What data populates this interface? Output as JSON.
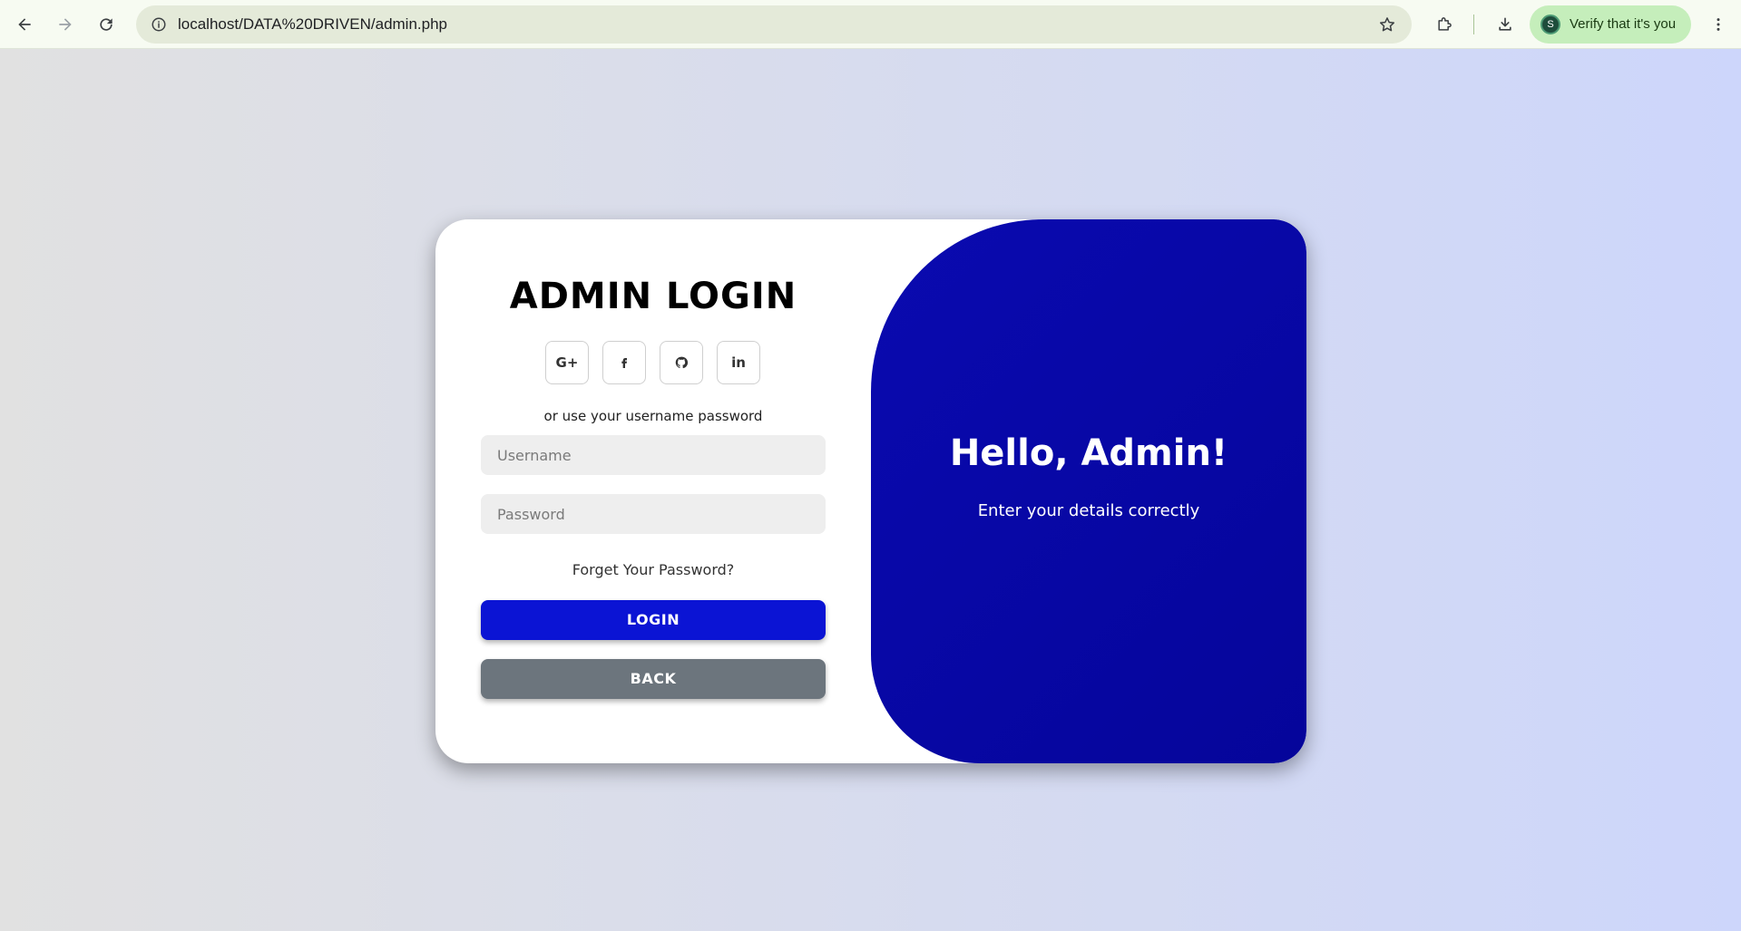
{
  "browser": {
    "url": "localhost/DATA%20DRIVEN/admin.php",
    "verify_label": "Verify that it's you",
    "avatar_letter": "S",
    "icons": {
      "back": "arrow-left-icon",
      "forward": "arrow-right-icon",
      "reload": "reload-icon",
      "site_info": "site-info-icon",
      "bookmark": "star-icon",
      "extensions": "puzzle-icon",
      "downloads": "download-icon",
      "menu": "kebab-menu-icon"
    }
  },
  "login_form": {
    "title": "ADMIN LOGIN",
    "social_buttons": [
      {
        "label": "G+",
        "icon": "google-plus-icon"
      },
      {
        "label": "",
        "icon": "facebook-icon"
      },
      {
        "label": "",
        "icon": "github-icon"
      },
      {
        "label": "in",
        "icon": "linkedin-icon"
      }
    ],
    "alt_text": "or use your username password",
    "username_placeholder": "Username",
    "password_placeholder": "Password",
    "forgot_label": "Forget Your Password?",
    "login_label": "LOGIN",
    "back_label": "BACK"
  },
  "welcome": {
    "title": "Hello, Admin!",
    "subtitle": "Enter your details correctly"
  },
  "colors": {
    "primary": "#0b14d4",
    "panel": "#0808a8",
    "secondary": "#6c757d",
    "input_bg": "#eeeeee"
  }
}
